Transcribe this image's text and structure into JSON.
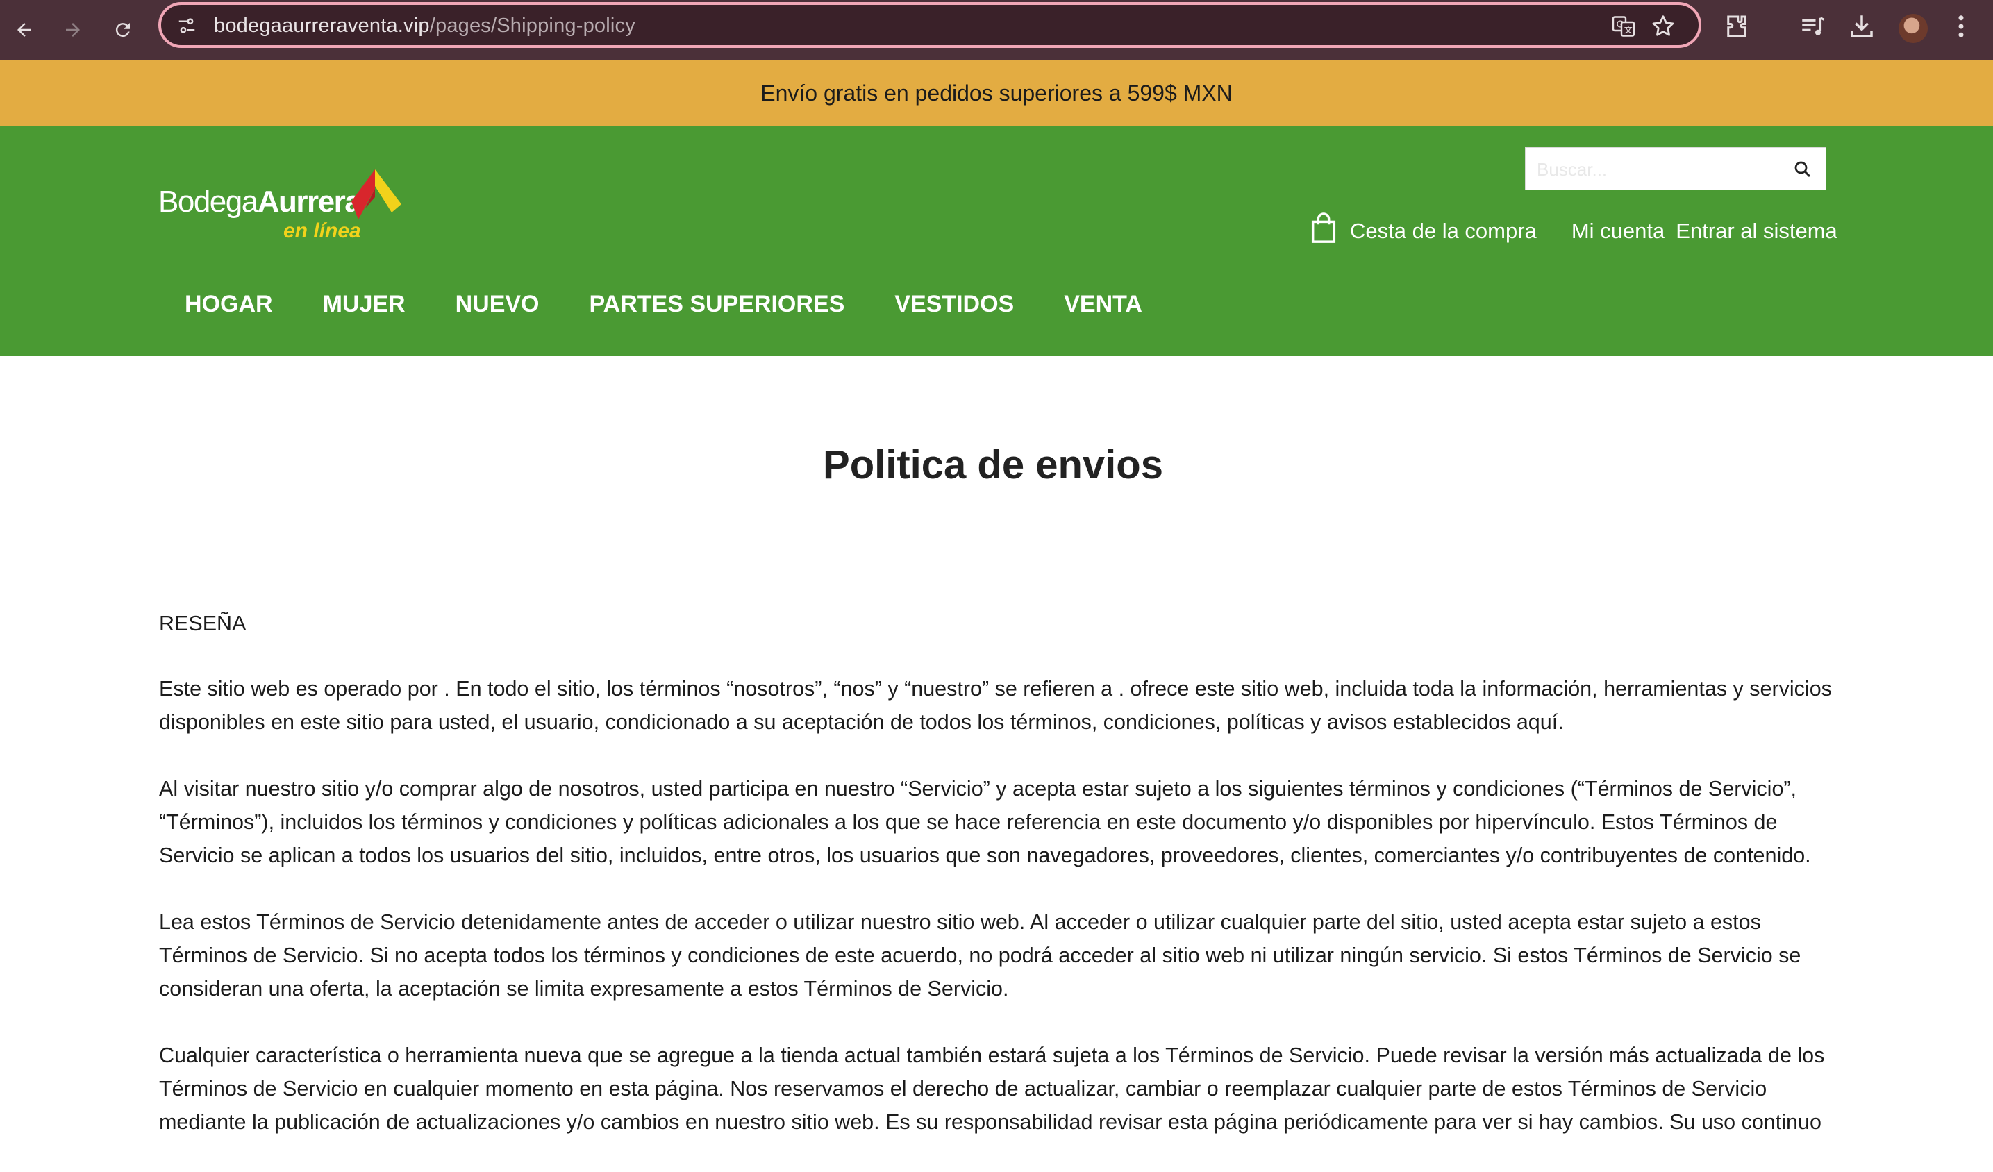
{
  "browser": {
    "url_domain": "bodegaaurreraventa.vip",
    "url_path": "/pages/Shipping-policy",
    "icons": [
      "back-arrow-icon",
      "forward-arrow-icon",
      "reload-icon",
      "site-settings-icon",
      "translate-icon",
      "star-icon",
      "extensions-icon",
      "media-playlist-icon",
      "download-icon",
      "avatar",
      "kebab-menu-icon"
    ]
  },
  "promo": {
    "text": "Envío gratis en pedidos superiores a 599$ MXN",
    "background": "#e3ac42"
  },
  "header": {
    "background": "#4a9a33",
    "logo": {
      "word_regular": "Bodega",
      "word_bold": "Aurrera",
      "tagline": "en línea",
      "accent_red": "#d8262c",
      "accent_yellow": "#f2d21b"
    },
    "search": {
      "placeholder": "Buscar..."
    },
    "account": {
      "cart_label": "Cesta de la compra",
      "account_label": "Mi cuenta",
      "login_label": "Entrar al sistema"
    },
    "nav": [
      {
        "label": "HOGAR"
      },
      {
        "label": "MUJER"
      },
      {
        "label": "NUEVO"
      },
      {
        "label": "PARTES SUPERIORES"
      },
      {
        "label": "VESTIDOS"
      },
      {
        "label": "VENTA"
      }
    ]
  },
  "page": {
    "title": "Politica de envios",
    "section_heading": "RESEÑA",
    "paragraphs": [
      "Este sitio web es operado por . En todo el sitio, los términos “nosotros”, “nos” y “nuestro” se refieren a . ofrece este sitio web, incluida toda la información, herramientas y servicios disponibles en este sitio para usted, el usuario, condicionado a su aceptación de todos los términos, condiciones, políticas y avisos establecidos aquí.",
      "Al visitar nuestro sitio y/o comprar algo de nosotros, usted participa en nuestro “Servicio” y acepta estar sujeto a los siguientes términos y condiciones (“Términos de Servicio”, “Términos”), incluidos los términos y condiciones y políticas adicionales a los que se hace referencia en este documento y/o disponibles por hipervínculo. Estos Términos de Servicio se aplican a todos los usuarios del sitio, incluidos, entre otros, los usuarios que son navegadores, proveedores, clientes, comerciantes y/o contribuyentes de contenido.",
      "Lea estos Términos de Servicio detenidamente antes de acceder o utilizar nuestro sitio web. Al acceder o utilizar cualquier parte del sitio, usted acepta estar sujeto a estos Términos de Servicio. Si no acepta todos los términos y condiciones de este acuerdo, no podrá acceder al sitio web ni utilizar ningún servicio. Si estos Términos de Servicio se consideran una oferta, la aceptación se limita expresamente a estos Términos de Servicio.",
      "Cualquier característica o herramienta nueva que se agregue a la tienda actual también estará sujeta a los Términos de Servicio. Puede revisar la versión más actualizada de los Términos de Servicio en cualquier momento en esta página. Nos reservamos el derecho de actualizar, cambiar o reemplazar cualquier parte de estos Términos de Servicio mediante la publicación de actualizaciones y/o cambios en nuestro sitio web. Es su responsabilidad revisar esta página periódicamente para ver si hay cambios. Su uso continuo"
    ]
  }
}
